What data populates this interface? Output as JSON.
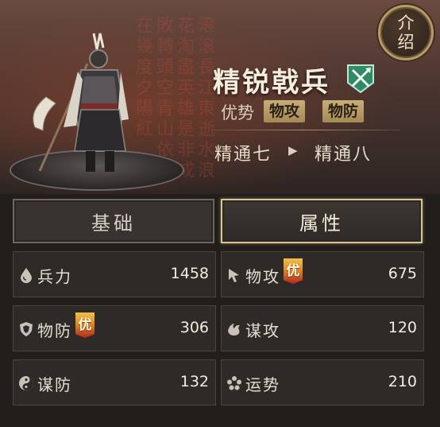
{
  "intro_button": {
    "chars": [
      "介",
      "绍"
    ]
  },
  "unit": {
    "name": "精锐戟兵",
    "type_icon": "crossed-halberds-icon",
    "advantage_label": "优势",
    "advantage_tags": [
      "物攻",
      "物防"
    ],
    "mastery_current": "精通七",
    "mastery_next": "精通八"
  },
  "background_calligraphy": "滚滚長江東逝水浪花淘盡英雄是非成敗轉頭空青山依舊在幾度夕陽紅",
  "tabs": [
    {
      "label": "基础",
      "active": false
    },
    {
      "label": "属性",
      "active": true
    }
  ],
  "stats": [
    {
      "label": "兵力",
      "value": "1458",
      "icon": "drop-icon",
      "advantage": false
    },
    {
      "label": "物攻",
      "value": "675",
      "icon": "sword-cursor-icon",
      "advantage": true
    },
    {
      "label": "物防",
      "value": "306",
      "icon": "shield-icon",
      "advantage": true
    },
    {
      "label": "谋攻",
      "value": "120",
      "icon": "flame-swirl-icon",
      "advantage": false
    },
    {
      "label": "谋防",
      "value": "132",
      "icon": "yin-yang-icon",
      "advantage": false
    },
    {
      "label": "运势",
      "value": "210",
      "icon": "flower-icon",
      "advantage": false
    }
  ],
  "advantage_badge": "优",
  "colors": {
    "accent_gold": "#c8ad78",
    "type_icon_green": "#2f8a66",
    "badge_red": "#b3251d"
  }
}
